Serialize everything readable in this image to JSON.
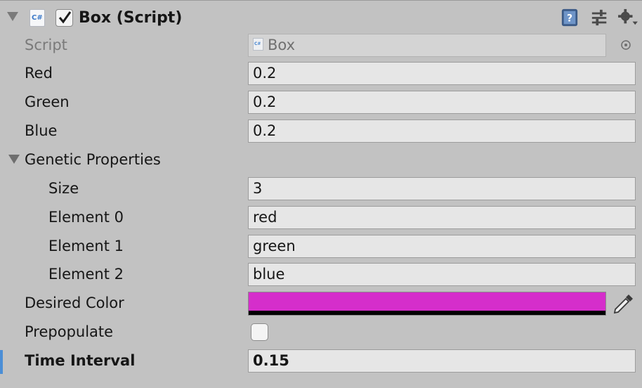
{
  "component": {
    "title": "Box (Script)",
    "enabled": true,
    "icon_text": "C#",
    "header_icons": [
      "help-book-icon",
      "presets-icon",
      "gear-icon"
    ]
  },
  "fields": {
    "script": {
      "label": "Script",
      "value": "Box",
      "icon_text": "C#"
    },
    "red": {
      "label": "Red",
      "value": "0.2"
    },
    "green": {
      "label": "Green",
      "value": "0.2"
    },
    "blue": {
      "label": "Blue",
      "value": "0.2"
    },
    "genetic": {
      "label": "Genetic Properties",
      "size_label": "Size",
      "size_value": "3",
      "elements": [
        {
          "label": "Element 0",
          "value": "red"
        },
        {
          "label": "Element 1",
          "value": "green"
        },
        {
          "label": "Element 2",
          "value": "blue"
        }
      ]
    },
    "desired_color": {
      "label": "Desired Color",
      "color": "#d52ecb"
    },
    "prepopulate": {
      "label": "Prepopulate",
      "checked": false
    },
    "time_interval": {
      "label": "Time Interval",
      "value": "0.15"
    }
  }
}
